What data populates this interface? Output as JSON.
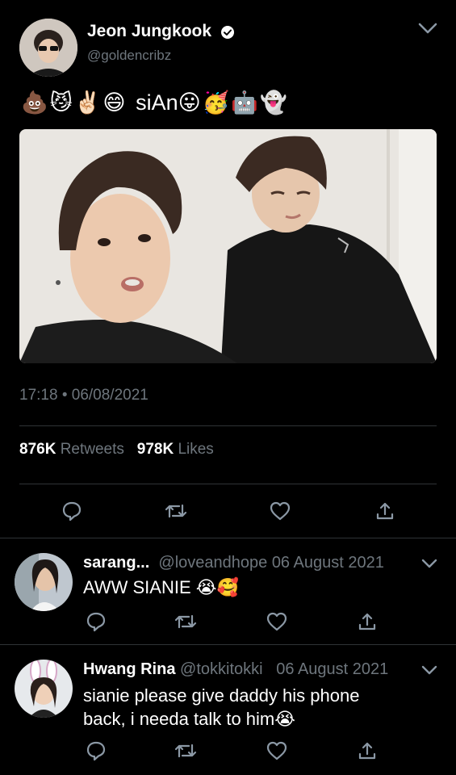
{
  "tweet": {
    "author_name": "Jeon Jungkook",
    "handle": "@goldencribz",
    "text_emojis_before": "💩😼✌🏻😄",
    "text_word": "siAn",
    "text_emojis_after": "😛🥳🤖👻",
    "timestamp": "17:18 • 06/08/2021",
    "retweets_count": "876K",
    "retweets_label": "Retweets",
    "likes_count": "978K",
    "likes_label": "Likes"
  },
  "replies": [
    {
      "name": "sarang...",
      "handle": "@loveandhope",
      "date": "06 August 2021",
      "text": "AWW SIANIE 😭🥰"
    },
    {
      "name": "Hwang Rina",
      "handle": "@tokkitokki",
      "date": "06 August 2021",
      "text_line1": "sianie please give daddy his phone",
      "text_line2": "back, i needa talk to him😭"
    }
  ],
  "colors": {
    "background": "#000000",
    "text": "#ffffff",
    "muted": "#6e767d",
    "divider": "#2f3336",
    "verified": "#ffffff"
  },
  "icons": [
    "chevron-down-icon",
    "verified-badge-icon",
    "reply-icon",
    "retweet-icon",
    "like-icon",
    "share-icon"
  ]
}
